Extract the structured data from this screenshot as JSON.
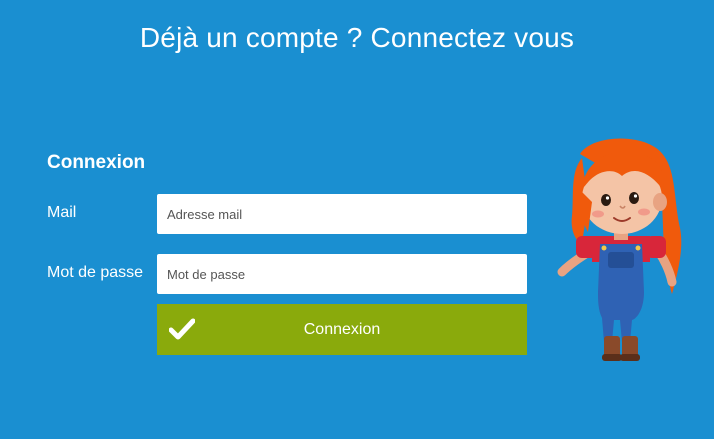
{
  "header": {
    "title": "Déjà un compte ? Connectez vous"
  },
  "login_form": {
    "title": "Connexion",
    "mail_label": "Mail",
    "mail_placeholder": "Adresse mail",
    "password_label": "Mot de passe",
    "password_placeholder": "Mot de passe",
    "submit_label": "Connexion",
    "submit_icon": "check-icon"
  },
  "colors": {
    "background": "#1a8fd1",
    "submit_button": "#8aaa0c",
    "text": "#ffffff"
  },
  "mascot": {
    "icon": "child-mascot-illustration"
  }
}
